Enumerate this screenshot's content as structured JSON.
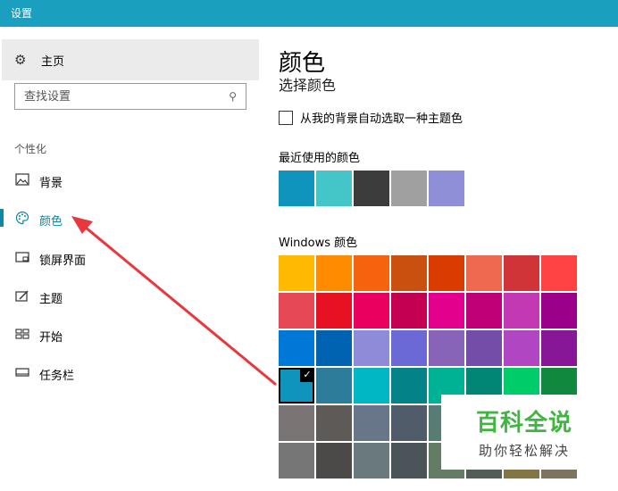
{
  "window": {
    "title": "设置"
  },
  "sidebar": {
    "home_label": "主页",
    "search_placeholder": "查找设置",
    "section_label": "个性化",
    "items": [
      {
        "label": "背景",
        "icon": "picture-icon"
      },
      {
        "label": "颜色",
        "icon": "palette-icon",
        "active": true
      },
      {
        "label": "锁屏界面",
        "icon": "lock-screen-icon"
      },
      {
        "label": "主题",
        "icon": "theme-icon"
      },
      {
        "label": "开始",
        "icon": "start-icon"
      },
      {
        "label": "任务栏",
        "icon": "taskbar-icon"
      }
    ]
  },
  "main": {
    "title": "颜色",
    "cut_header": "选择颜色",
    "auto_color_checkbox": {
      "label": "从我的背景自动选取一种主题色",
      "checked": false
    },
    "recent_label": "最近使用的颜色",
    "recent_colors": [
      "#0f95bd",
      "#44c6c8",
      "#3c3c3c",
      "#a0a0a0",
      "#8e8fd6"
    ],
    "windows_colors_label": "Windows 颜色",
    "windows_colors": [
      "#ffb900",
      "#ff8c00",
      "#f7630c",
      "#ca5010",
      "#da3b01",
      "#ef6950",
      "#d13438",
      "#ff4343",
      "#e74856",
      "#e81123",
      "#ea005e",
      "#c30052",
      "#e3008c",
      "#bf0077",
      "#c239b3",
      "#9a0089",
      "#0078d7",
      "#0063b1",
      "#8e8cd8",
      "#6b69d6",
      "#8764b8",
      "#744da9",
      "#b146c2",
      "#881798",
      "#0f95bd",
      "#2d7d9a",
      "#00b7c3",
      "#038387",
      "#00b294",
      "#018574",
      "#00cc6a",
      "#10893e",
      "#7a7574",
      "#5d5a58",
      "#68768a",
      "#515c6b",
      "#567c73",
      "#486860",
      "#498205",
      "#107c10",
      "#767676",
      "#4c4a48",
      "#69797e",
      "#4a5459",
      "#647c64",
      "#525e54",
      "#847545",
      "#7e735f"
    ],
    "selected_index": 24
  },
  "watermark": {
    "title": "百科全说",
    "subtitle": "助你轻松解决"
  },
  "annotation": {
    "arrow_color": "#e8383d"
  }
}
